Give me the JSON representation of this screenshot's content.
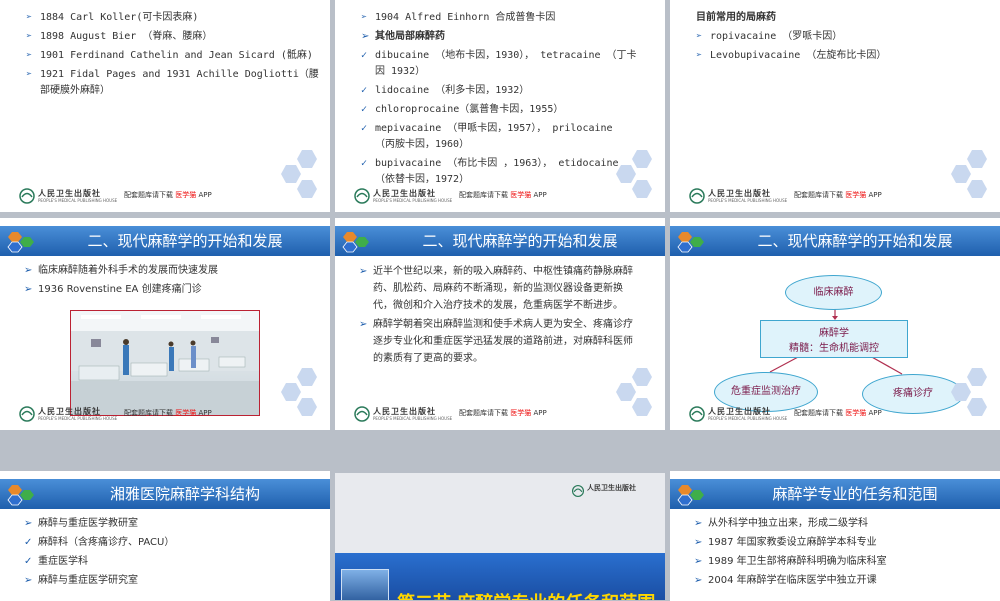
{
  "common": {
    "publisher": "人民卫生出版社",
    "publisher_en": "PEOPLE'S MEDICAL PUBLISHING HOUSE",
    "ad_text": "配套题库请下载",
    "ad_app": "医学猫",
    "ad_suffix": "APP"
  },
  "slide1": {
    "items": [
      "1884 Carl Koller(可卡因表麻)",
      "1898 August Bier （脊麻、腰麻）",
      "1901 Ferdinand Cathelin and Jean Sicard  (骶麻)",
      "1921 Fidal Pages and 1931 Achille Dogliotti（腰部硬膜外麻醉）"
    ]
  },
  "slide2": {
    "items": [
      "1904 Alfred Einhorn  合成普鲁卡因",
      "其他局部麻醉药",
      "dibucaine （地布卡因，1930）， tetracaine （丁卡因 1932）",
      "lidocaine （利多卡因，1932）",
      "chloroprocaine（氯普鲁卡因，1955）",
      "mepivacaine （甲哌卡因，1957）， prilocaine （丙胺卡因，1960）",
      "bupivacaine （布比卡因  ，1963）， etidocaine （依替卡因，1972）"
    ]
  },
  "slide3": {
    "heading": "目前常用的局麻药",
    "items": [
      "ropivacaine （罗哌卡因）",
      "Levobupivacaine （左旋布比卡因）"
    ]
  },
  "slide4": {
    "title": "二、现代麻醉学的开始和发展",
    "items": [
      "临床麻醉随着外科手术的发展而快速发展",
      "1936 Rovenstine EA  创建疼痛门诊"
    ]
  },
  "slide5": {
    "title": "二、现代麻醉学的开始和发展",
    "items": [
      "近半个世纪以来，新的吸入麻醉药、中枢性镇痛药静脉麻醉药、肌松药、局麻药不断涌现，新的监测仪器设备更新换代，微创和介入治疗技术的发展，危重病医学不断进步。",
      "麻醉学朝着突出麻醉监测和使手术病人更为安全、疼痛诊疗逐步专业化和重症医学迅猛发展的道路前进，对麻醉科医师的素质有了更高的要求。"
    ]
  },
  "slide6": {
    "title": "二、现代麻醉学的开始和发展",
    "diagram": {
      "top": "临床麻醉",
      "center_line1": "麻醉学",
      "center_line2": "精髓：生命机能调控",
      "left": "危重症监测治疗",
      "right": "疼痛诊疗"
    }
  },
  "slide7": {
    "title": "湘雅医院麻醉学科结构",
    "items": [
      "麻醉与重症医学教研室",
      "麻醉科（含疼痛诊疗、PACU）",
      "重症医学科",
      "麻醉与重症医学研究室"
    ]
  },
  "slide8": {
    "section_title": "第二节  麻醉学专业的任务和范围"
  },
  "slide9": {
    "title": "麻醉学专业的任务和范围",
    "items": [
      "从外科学中独立出来，形成二级学科",
      "1987 年国家教委设立麻醉学本科专业",
      "1989 年卫生部将麻醉科明确为临床科室",
      "2004 年麻醉学在临床医学中独立开课"
    ]
  },
  "colors": {
    "header_blue": "#1f5fad",
    "diagram_text": "#7b1a4a",
    "section_title": "#ffd700"
  }
}
